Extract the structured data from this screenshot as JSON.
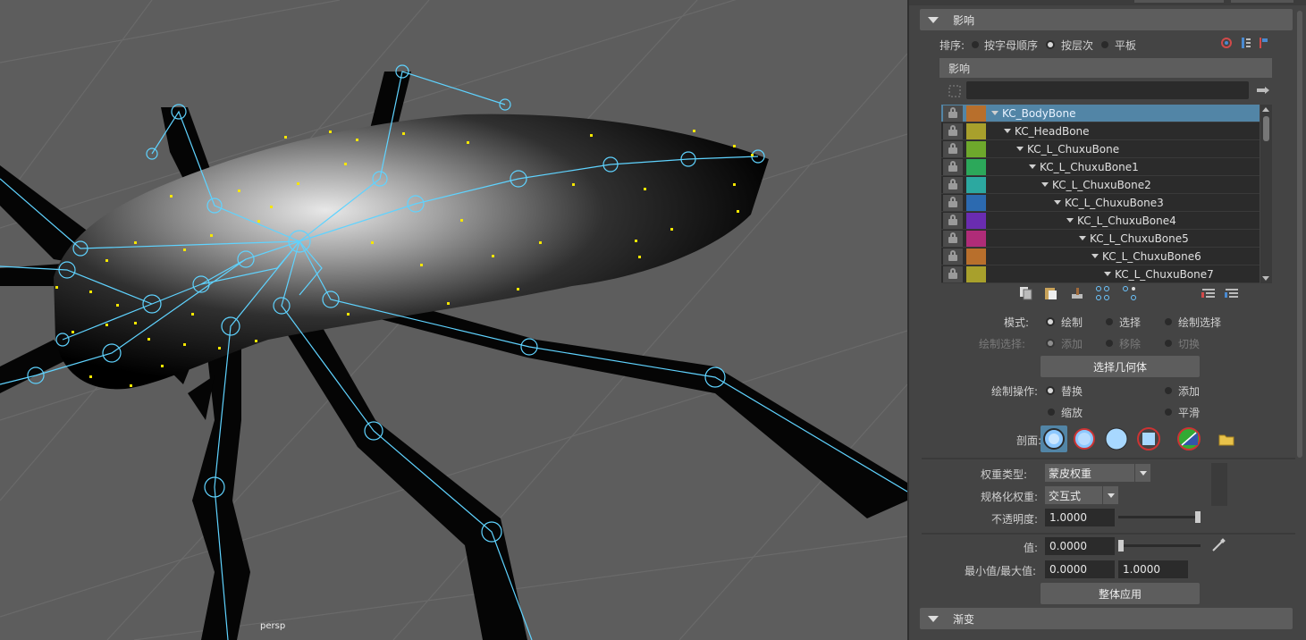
{
  "viewport": {
    "camera_label": "persp"
  },
  "panel": {
    "influence_section": {
      "title": "影响"
    },
    "sort": {
      "label": "排序:",
      "options": [
        "按字母顺序",
        "按层次",
        "平板"
      ],
      "selected": "按层次"
    },
    "influence_subheader": "影响",
    "filter_value": "",
    "joints": [
      {
        "name": "KC_BodyBone",
        "color": "#b86f2c",
        "selected": true
      },
      {
        "name": "KC_HeadBone",
        "color": "#a8a02c",
        "selected": false
      },
      {
        "name": "KC_L_ChuxuBone",
        "color": "#6ea82c",
        "selected": false
      },
      {
        "name": "KC_L_ChuxuBone1",
        "color": "#2ca85a",
        "selected": false
      },
      {
        "name": "KC_L_ChuxuBone2",
        "color": "#2ca8a0",
        "selected": false
      },
      {
        "name": "KC_L_ChuxuBone3",
        "color": "#2c6ab0",
        "selected": false
      },
      {
        "name": "KC_L_ChuxuBone4",
        "color": "#6a2cb0",
        "selected": false
      },
      {
        "name": "KC_L_ChuxuBone5",
        "color": "#b02c78",
        "selected": false
      },
      {
        "name": "KC_L_ChuxuBone6",
        "color": "#b86f2c",
        "selected": false
      },
      {
        "name": "KC_L_ChuxuBone7",
        "color": "#a8a02c",
        "selected": false
      }
    ],
    "mode": {
      "label": "模式:",
      "options": [
        "绘制",
        "选择",
        "绘制选择"
      ],
      "selected": "绘制"
    },
    "paint_select": {
      "label": "绘制选择:",
      "options": [
        "添加",
        "移除",
        "切换"
      ]
    },
    "select_geometry_button": "选择几何体",
    "paint_operation": {
      "label": "绘制操作:",
      "options": [
        "替换",
        "添加",
        "缩放",
        "平滑"
      ],
      "selected": "替换"
    },
    "profile_label": "剖面:",
    "weight_type": {
      "label": "权重类型:",
      "value": "蒙皮权重"
    },
    "normalize_weights": {
      "label": "规格化权重:",
      "value": "交互式"
    },
    "opacity": {
      "label": "不透明度:",
      "value": "1.0000",
      "level": 1.0
    },
    "value": {
      "label": "值:",
      "value": "0.0000",
      "level": 0.0
    },
    "min_max": {
      "label": "最小值/最大值:",
      "min": "0.0000",
      "max": "1.0000"
    },
    "flood_button": "整体应用",
    "gradient_section": {
      "title": "渐变"
    },
    "accent_color": "#5285a6"
  }
}
